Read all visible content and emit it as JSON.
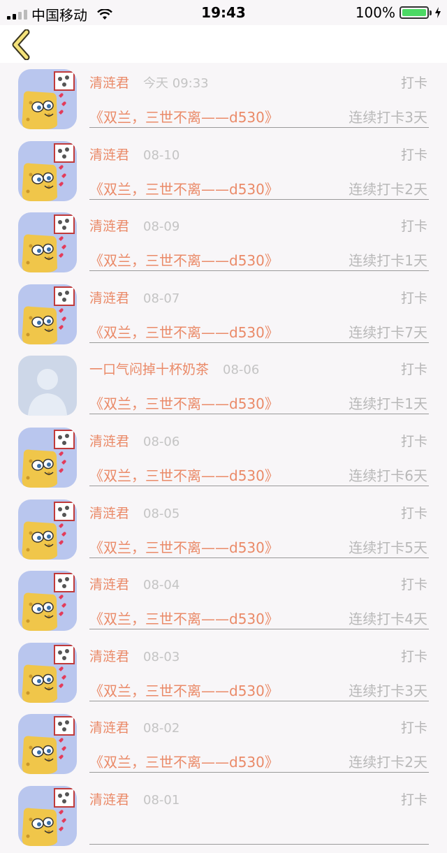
{
  "status_bar": {
    "carrier": "中国移动",
    "time": "19:43",
    "battery": "100%"
  },
  "colors": {
    "accent": "#ea8a68",
    "muted": "#b8b8b8",
    "avatar_bg": "#b8c6ec",
    "battery": "#4cd964"
  },
  "nav": {
    "back_icon": "chevron-left-icon"
  },
  "rows": [
    {
      "name": "清涟君",
      "date": "今天 09:33",
      "action": "打卡",
      "title": "《双兰，三世不离——d530》",
      "streak": "连续打卡3天",
      "avatar": "spongebob-avatar"
    },
    {
      "name": "清涟君",
      "date": "08-10",
      "action": "打卡",
      "title": "《双兰，三世不离——d530》",
      "streak": "连续打卡2天",
      "avatar": "spongebob-avatar"
    },
    {
      "name": "清涟君",
      "date": "08-09",
      "action": "打卡",
      "title": "《双兰，三世不离——d530》",
      "streak": "连续打卡1天",
      "avatar": "spongebob-avatar"
    },
    {
      "name": "清涟君",
      "date": "08-07",
      "action": "打卡",
      "title": "《双兰，三世不离——d530》",
      "streak": "连续打卡7天",
      "avatar": "spongebob-avatar"
    },
    {
      "name": "一口气闷掉十杯奶茶",
      "date": "08-06",
      "action": "打卡",
      "title": "《双兰，三世不离——d530》",
      "streak": "连续打卡1天",
      "avatar": "default-avatar"
    },
    {
      "name": "清涟君",
      "date": "08-06",
      "action": "打卡",
      "title": "《双兰，三世不离——d530》",
      "streak": "连续打卡6天",
      "avatar": "spongebob-avatar"
    },
    {
      "name": "清涟君",
      "date": "08-05",
      "action": "打卡",
      "title": "《双兰，三世不离——d530》",
      "streak": "连续打卡5天",
      "avatar": "spongebob-avatar"
    },
    {
      "name": "清涟君",
      "date": "08-04",
      "action": "打卡",
      "title": "《双兰，三世不离——d530》",
      "streak": "连续打卡4天",
      "avatar": "spongebob-avatar"
    },
    {
      "name": "清涟君",
      "date": "08-03",
      "action": "打卡",
      "title": "《双兰，三世不离——d530》",
      "streak": "连续打卡3天",
      "avatar": "spongebob-avatar"
    },
    {
      "name": "清涟君",
      "date": "08-02",
      "action": "打卡",
      "title": "《双兰，三世不离——d530》",
      "streak": "连续打卡2天",
      "avatar": "spongebob-avatar"
    },
    {
      "name": "清涟君",
      "date": "08-01",
      "action": "打卡",
      "title": "",
      "streak": "",
      "avatar": "spongebob-avatar"
    }
  ]
}
